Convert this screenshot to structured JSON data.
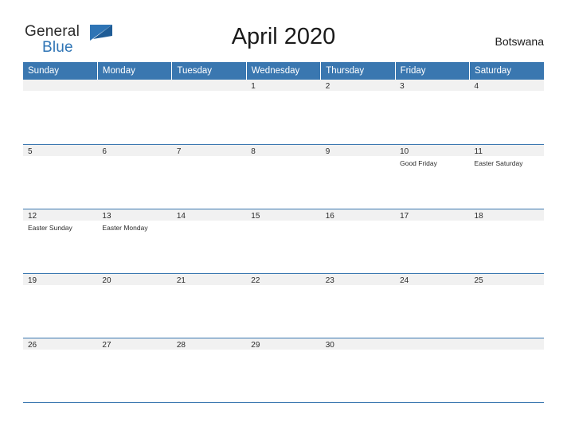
{
  "brand": {
    "word_general": "General",
    "word_blue": "Blue",
    "mark": "triangle-logo-mark"
  },
  "header": {
    "title": "April 2020",
    "country": "Botswana"
  },
  "calendar": {
    "weekday_headers": [
      "Sunday",
      "Monday",
      "Tuesday",
      "Wednesday",
      "Thursday",
      "Friday",
      "Saturday"
    ],
    "accent_color": "#3a77b0",
    "band_color": "#f1f1f1",
    "weeks": [
      [
        {
          "day": "",
          "event": ""
        },
        {
          "day": "",
          "event": ""
        },
        {
          "day": "",
          "event": ""
        },
        {
          "day": "1",
          "event": ""
        },
        {
          "day": "2",
          "event": ""
        },
        {
          "day": "3",
          "event": ""
        },
        {
          "day": "4",
          "event": ""
        }
      ],
      [
        {
          "day": "5",
          "event": ""
        },
        {
          "day": "6",
          "event": ""
        },
        {
          "day": "7",
          "event": ""
        },
        {
          "day": "8",
          "event": ""
        },
        {
          "day": "9",
          "event": ""
        },
        {
          "day": "10",
          "event": "Good Friday"
        },
        {
          "day": "11",
          "event": "Easter Saturday"
        }
      ],
      [
        {
          "day": "12",
          "event": "Easter Sunday"
        },
        {
          "day": "13",
          "event": "Easter Monday"
        },
        {
          "day": "14",
          "event": ""
        },
        {
          "day": "15",
          "event": ""
        },
        {
          "day": "16",
          "event": ""
        },
        {
          "day": "17",
          "event": ""
        },
        {
          "day": "18",
          "event": ""
        }
      ],
      [
        {
          "day": "19",
          "event": ""
        },
        {
          "day": "20",
          "event": ""
        },
        {
          "day": "21",
          "event": ""
        },
        {
          "day": "22",
          "event": ""
        },
        {
          "day": "23",
          "event": ""
        },
        {
          "day": "24",
          "event": ""
        },
        {
          "day": "25",
          "event": ""
        }
      ],
      [
        {
          "day": "26",
          "event": ""
        },
        {
          "day": "27",
          "event": ""
        },
        {
          "day": "28",
          "event": ""
        },
        {
          "day": "29",
          "event": ""
        },
        {
          "day": "30",
          "event": ""
        },
        {
          "day": "",
          "event": ""
        },
        {
          "day": "",
          "event": ""
        }
      ]
    ]
  }
}
